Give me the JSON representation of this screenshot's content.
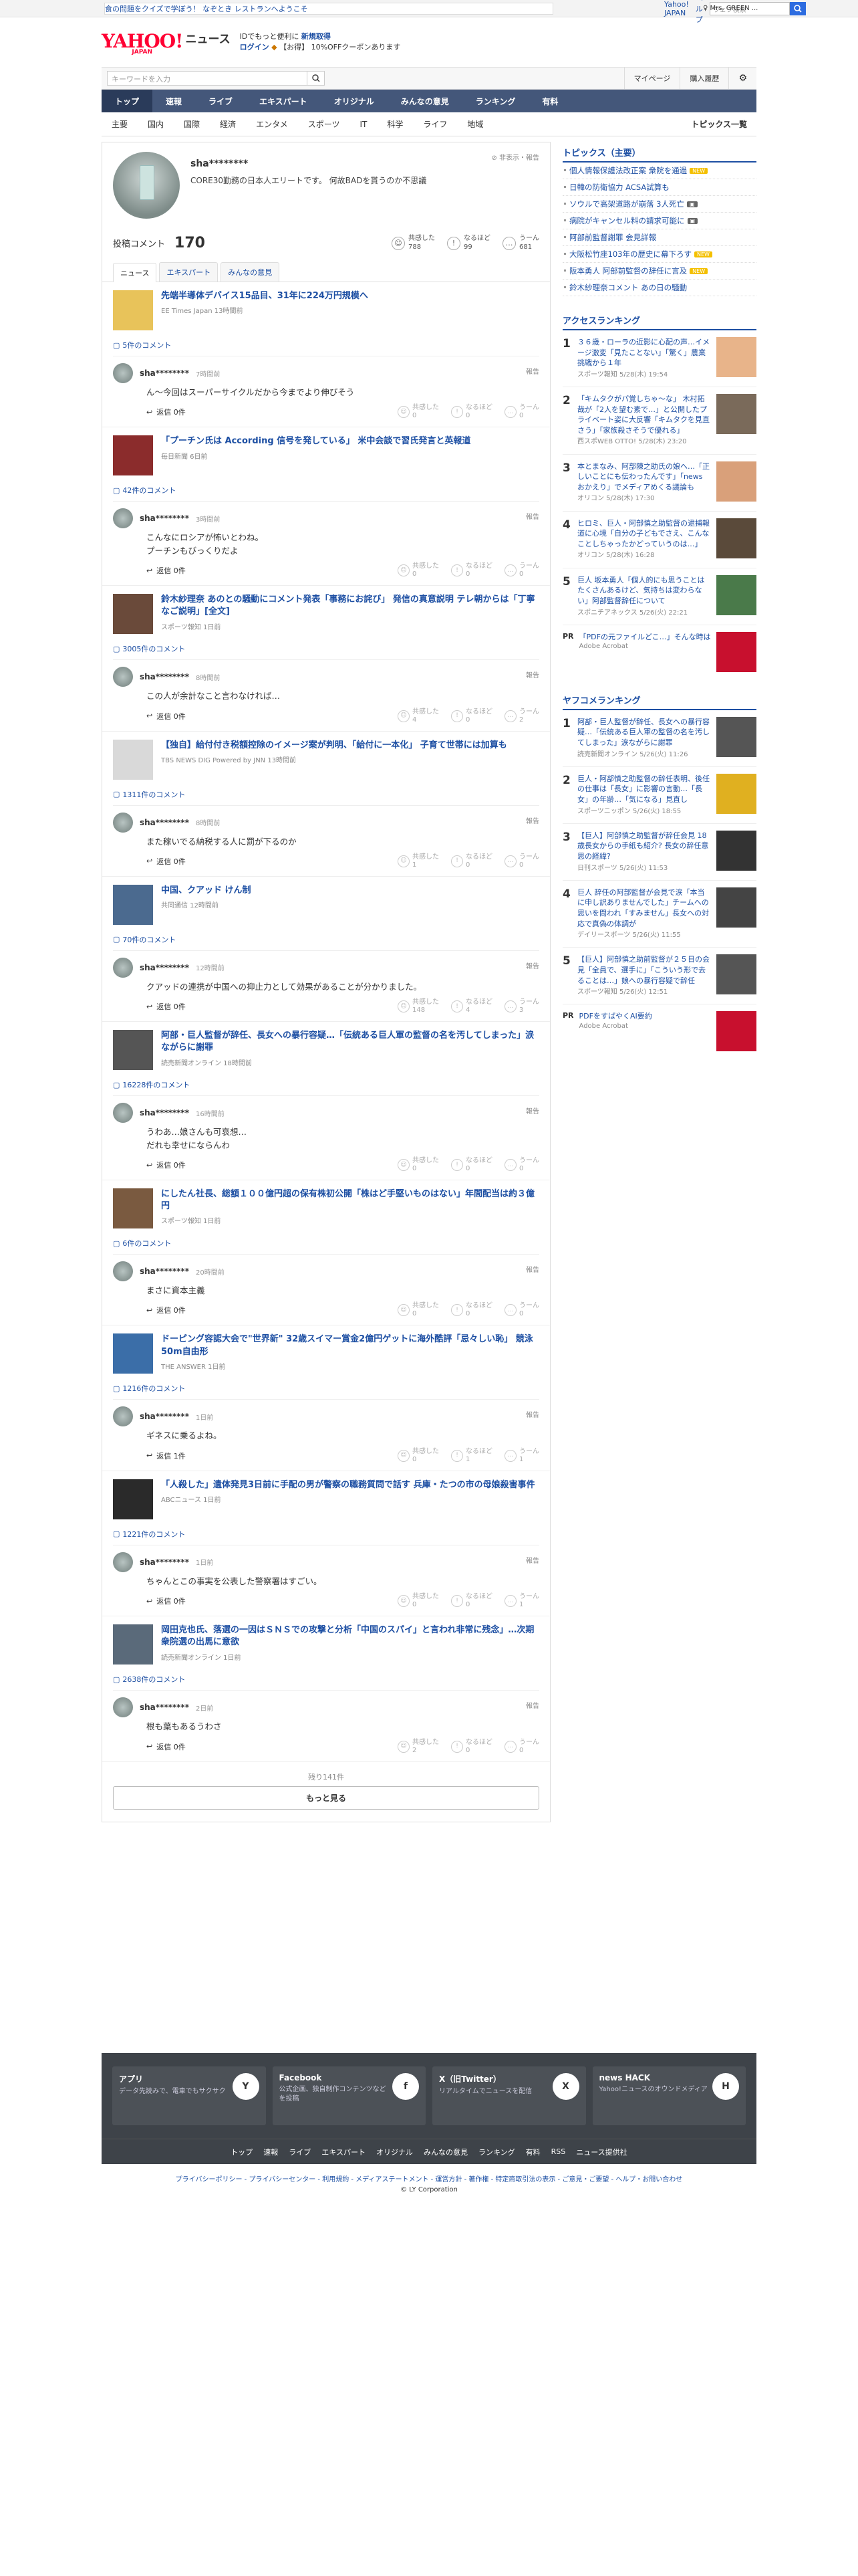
{
  "topbar": {
    "left": "食の問題をクイズで学ぼう！ なぞとき レストランへようこそ",
    "links": [
      "Yahoo! JAPAN",
      "ヘルプ"
    ],
    "search_placeholder": "ウェブ検索",
    "user": "♀ Mrs. GREEN ..."
  },
  "header": {
    "logo": "YAHOO!",
    "logo_sub": "JAPAN",
    "logo_section": "ニュース",
    "info_line1": "IDでもっと便利に",
    "info_line1_b": "新規取得",
    "login": "ログイン",
    "promo": "【お得】 10%OFFクーポンあります"
  },
  "search": {
    "placeholder": "キーワードを入力",
    "mypage": "マイページ",
    "history": "購入履歴"
  },
  "gnav": [
    "トップ",
    "速報",
    "ライブ",
    "エキスパート",
    "オリジナル",
    "みんなの意見",
    "ランキング",
    "有料"
  ],
  "subnav": [
    "主要",
    "国内",
    "国際",
    "経済",
    "エンタメ",
    "スポーツ",
    "IT",
    "科学",
    "ライフ",
    "地域"
  ],
  "subnav_right": "トピックス一覧",
  "profile": {
    "name": "sha********",
    "desc": "CORE30勤務の日本人エリートです。 何故BADを貰うのか不思議",
    "tools": "非表示・報告",
    "comments_label": "投稿コメント",
    "comments_count": "170",
    "empathy_label": "共感した",
    "empathy": "788",
    "naruhodo_label": "なるほど",
    "naruhodo": "99",
    "un_label": "うーん",
    "un": "681"
  },
  "tabs": [
    "ニュース",
    "エキスパート",
    "みんなの意見"
  ],
  "comments": [
    {
      "title": "先端半導体デバイス15品目、31年に224万円規模へ",
      "src": "EE Times Japan 13時間前",
      "count": "5件のコメント",
      "time": "7時間前",
      "text": "ん～今回はスーパーサイクルだから今までより伸びそう",
      "reply": "返信 0件",
      "r1": "0",
      "r2": "0",
      "r3": "0",
      "thumb": "#e8c35a"
    },
    {
      "title": "「プーチン氏は According 信号を発している」 米中会談で習氏発言と英報道",
      "src": "毎日新聞 6日前",
      "count": "42件のコメント",
      "time": "3時間前",
      "text": "こんなにロシアが怖いとわね。\nプーチンもびっくりだよ",
      "reply": "返信 0件",
      "r1": "0",
      "r2": "0",
      "r3": "0",
      "thumb": "#8b2c2c"
    },
    {
      "title": "鈴木紗理奈 あのとの騒動にコメント発表「事務にお詫び」 発信の真意説明 テレ朝からは「丁寧なご説明」[全文]",
      "src": "スポーツ報知 1日前",
      "count": "3005件のコメント",
      "time": "8時間前",
      "text": "この人が余計なこと言わなければ…",
      "reply": "返信 0件",
      "r1": "4",
      "r2": "0",
      "r3": "2",
      "thumb": "#6a4a3a"
    },
    {
      "title": "【独自】給付付き税額控除のイメージ案が判明、「給付に一本化」 子育て世帯には加算も",
      "src": "TBS NEWS DIG Powered by JNN 13時間前",
      "count": "1311件のコメント",
      "time": "8時間前",
      "text": "また稼いでる納税する人に罰が下るのか",
      "reply": "返信 0件",
      "r1": "1",
      "r2": "0",
      "r3": "0",
      "thumb": "#d9d9d9"
    },
    {
      "title": "中国、クアッド けん制",
      "src": "共同通信 12時間前",
      "count": "70件のコメント",
      "time": "12時間前",
      "text": "クアッドの連携が中国への抑止力として効果があることが分かりました。",
      "reply": "返信 0件",
      "r1": "148",
      "r2": "4",
      "r3": "3",
      "thumb": "#4b6a8f"
    },
    {
      "title": "阿部・巨人監督が辞任、長女への暴行容疑…「伝統ある巨人軍の監督の名を汚してしまった」涙ながらに謝罪",
      "src": "読売新聞オンライン 18時間前",
      "count": "16228件のコメント",
      "time": "16時間前",
      "text": "うわあ…娘さんも可哀想…\nだれも幸せにならんわ",
      "reply": "返信 0件",
      "r1": "0",
      "r2": "0",
      "r3": "0",
      "thumb": "#555"
    },
    {
      "title": "にしたん社長、総額１００億円超の保有株初公開「株はど手堅いものはない」年間配当は約３億円",
      "src": "スポーツ報知 1日前",
      "count": "6件のコメント",
      "time": "20時間前",
      "text": "まさに資本主義",
      "reply": "返信 0件",
      "r1": "0",
      "r2": "0",
      "r3": "0",
      "thumb": "#7a5a40"
    },
    {
      "title": "ドーピング容認大会で\"世界新\" 32歳スイマー賞金2億円ゲットに海外酷評「忌々しい恥」 競泳50m自由形",
      "src": "THE ANSWER 1日前",
      "count": "1216件のコメント",
      "time": "1日前",
      "text": "ギネスに乗るよね。",
      "reply": "返信 1件",
      "r1": "0",
      "r2": "1",
      "r3": "1",
      "thumb": "#3b6ea8"
    },
    {
      "title": "「人殺した」遺体発見3日前に手配の男が警察の職務質問で話す 兵庫・たつの市の母娘殺害事件",
      "src": "ABCニュース 1日前",
      "count": "1221件のコメント",
      "time": "1日前",
      "text": "ちゃんとこの事実を公表した警察署はすごい。",
      "reply": "返信 0件",
      "r1": "0",
      "r2": "0",
      "r3": "1",
      "thumb": "#2a2a2a"
    },
    {
      "title": "岡田克也氏、落選の一因はＳＮＳでの攻撃と分析「中国のスパイ」と言われ非常に残念」…次期衆院選の出馬に意欲",
      "src": "読売新聞オンライン 1日前",
      "count": "2638件のコメント",
      "time": "2日前",
      "text": "根も葉もあるうわさ",
      "reply": "返信 0件",
      "r1": "2",
      "r2": "0",
      "r3": "0",
      "thumb": "#5a6a7a"
    }
  ],
  "more": {
    "remaining": "残り141件",
    "button": "もっと見る"
  },
  "topics": {
    "title": "トピックス（主要）",
    "items": [
      {
        "t": "個人情報保護法改正案 衆院を通過",
        "b": "NEW"
      },
      {
        "t": "日韓の防衛協力 ACSA試算も",
        "b": ""
      },
      {
        "t": "ソウルで高架道路が崩落 3人死亡",
        "b": "img"
      },
      {
        "t": "病院がキャンセル料の請求可能に",
        "b": "img"
      },
      {
        "t": "阿部前監督謝罪 会見詳報",
        "b": ""
      },
      {
        "t": "大阪松竹座103年の歴史に幕下ろす",
        "b": "NEW"
      },
      {
        "t": "阪本勇人 阿部前監督の辞任に言及",
        "b": "NEW"
      },
      {
        "t": "鈴木紗理奈コメント あの日の騒動",
        "b": ""
      }
    ]
  },
  "access": {
    "title": "アクセスランキング",
    "items": [
      {
        "t": "３６歳・ローラの近影に心配の声…イメージ激変「見たことない」「驚く」農業挑戦から１年",
        "s": "スポーツ報知 5/28(木) 19:54"
      },
      {
        "t": "「キムタクがパ覚しちゃ～な」 木村拓哉が「2人を望む素で…」と公開したプライベート姿に大反響「キムタクを見直さう」「家族殺さそうで優れる」",
        "s": "西スポWEB OTTO! 5/28(木) 23:20"
      },
      {
        "t": "本とまなみ、阿部陳之助氏の娘へ…「正しいことにも伝わったんです」「news おかえり」でメディアめくる議論も",
        "s": "オリコン 5/28(木) 17:30"
      },
      {
        "t": "ヒロミ、巨人・阿部慎之助監督の逮捕報道に心境「自分の子どもでさえ、こんなことしちゃったかどっていうのは…」",
        "s": "オリコン 5/28(木) 16:28"
      },
      {
        "t": "巨人 坂本勇人「個人的にも思うことはたくさんあるけど、気持ちは変わらない」阿部監督辞任について",
        "s": "スポニチアネックス 5/26(火) 22:21"
      }
    ]
  },
  "pr1": {
    "tag": "PR",
    "t": "「PDFの元ファイルどこ…」そんな時は",
    "s": "Adobe Acrobat"
  },
  "yahoo_rank": {
    "title": "ヤフコメランキング",
    "items": [
      {
        "t": "阿部・巨人監督が辞任、長女への暴行容疑…「伝統ある巨人軍の監督の名を汚してしまった」涙ながらに謝罪",
        "s": "読売新聞オンライン 5/26(火) 11:26"
      },
      {
        "t": "巨人・阿部慎之助監督の辞任表明、後任の仕事は「長女」に影響の言動…「長女」の年齢…「気になる」見直し",
        "s": "スポーツニッポン 5/26(火) 18:55"
      },
      {
        "t": "【巨人】阿部慎之助監督が辞任会見 18歳長女からの手紙も紹介? 長女の辞任意思の経緯?",
        "s": "日刊スポーツ 5/26(火) 11:53"
      },
      {
        "t": "巨人 辞任の阿部監督が会見で涙「本当に申し訳ありませんでした」チームへの思いを問われ「すみません」長女への対応で真偽の体調が",
        "s": "デイリースポーツ 5/26(火) 11:55"
      },
      {
        "t": "【巨人】阿部慎之助前監督が２５日の会見「全員で、選手に」「こういう形で去ることは…」娘への暴行容疑で辞任",
        "s": "スポーツ報知 5/26(火) 12:51"
      }
    ]
  },
  "pr2": {
    "tag": "PR",
    "t": "PDFをすばやくAI要約",
    "s": "Adobe Acrobat"
  },
  "footer": {
    "boxes": [
      {
        "t": "アプリ",
        "d": "データ先読みで、電車でもサクサク",
        "ic": "Y"
      },
      {
        "t": "Facebook",
        "d": "公式企画、独自制作コンテンツなどを投稿",
        "ic": "f"
      },
      {
        "t": "X（旧Twitter）",
        "d": "リアルタイムでニュースを配信",
        "ic": "X"
      },
      {
        "t": "news HACK",
        "d": "Yahoo!ニュースのオウンドメディア",
        "ic": "H"
      }
    ],
    "nav": [
      "トップ",
      "速報",
      "ライブ",
      "エキスパート",
      "オリジナル",
      "みんなの意見",
      "ランキング",
      "有料",
      "RSS",
      "ニュース提供社"
    ],
    "links": "プライバシーポリシー - プライバシーセンター - 利用規約 - メディアステートメント - 運営方針 - 著作権 - 特定商取引法の表示 - ご意見・ご要望 - ヘルプ・お問い合わせ",
    "copy": "© LY Corporation"
  }
}
